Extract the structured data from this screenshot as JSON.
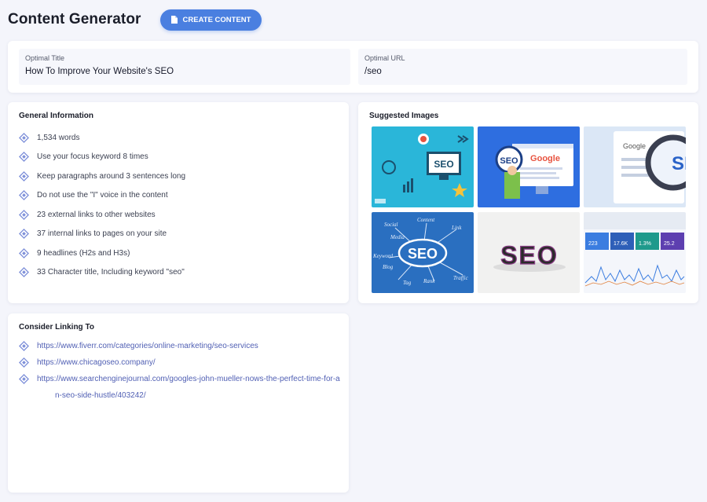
{
  "header": {
    "title": "Content Generator",
    "create_label": "CREATE CONTENT"
  },
  "optimal": {
    "title_label": "Optimal Title",
    "title_value": "How To Improve Your Website's SEO",
    "url_label": "Optimal URL",
    "url_value": "/seo"
  },
  "general": {
    "heading": "General Information",
    "items": [
      "1,534 words",
      "Use your focus keyword 8 times",
      "Keep paragraphs around 3 sentences long",
      "Do not use the \"I\" voice in the content",
      "23 external links to other websites",
      "37 internal links to pages on your site",
      "9 headlines (H2s and H3s)",
      "33 Character title, Including keyword \"seo\""
    ]
  },
  "images": {
    "heading": "Suggested Images",
    "thumb_texts": {
      "seo": "SEO",
      "google": "Google",
      "partial": "SE",
      "social": "Social",
      "media": "Media",
      "content": "Content",
      "link": "Link",
      "keyword": "Keyword",
      "blog": "Blog",
      "tag": "Tag",
      "rank": "Rank",
      "traffic": "Traffic",
      "stat1": "223",
      "stat2": "17.6K",
      "stat3": "1.3%",
      "stat4": "25.2"
    }
  },
  "links": {
    "heading": "Consider Linking To",
    "items": [
      "https://www.fiverr.com/categories/online-marketing/seo-services",
      "https://www.chicagoseo.company/",
      "https://www.searchenginejournal.com/googles-john-mueller-nows-the-perfect-time-for-an-seo-side-hustle/403242/"
    ]
  },
  "colors": {
    "accent": "#4a7fe0",
    "link": "#5160b4",
    "bullet": "#7d8fd9"
  }
}
